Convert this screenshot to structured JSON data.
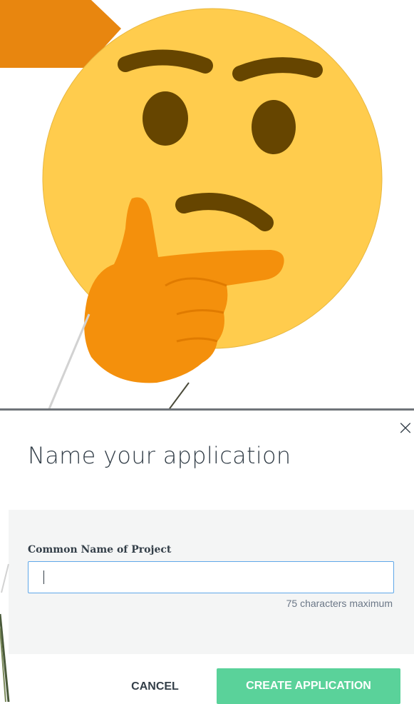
{
  "modal": {
    "title": "Name your application",
    "close_icon": "×",
    "field_label": "Common Name of Project",
    "field_value": "",
    "char_limit_hint": "75 characters maximum",
    "cancel_label": "CANCEL",
    "create_label": "CREATE APPLICATION"
  },
  "colors": {
    "primary_button": "#5ad29a",
    "input_focus_border": "#5fa7e8",
    "emoji_face": "#ffcc4d",
    "emoji_hand": "#f4900c",
    "emoji_features": "#664500"
  }
}
